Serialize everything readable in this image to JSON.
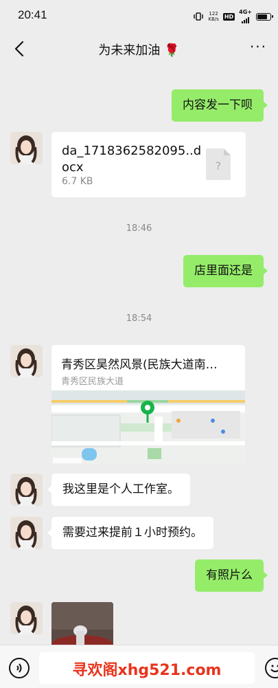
{
  "status": {
    "time": "20:41",
    "speed_value": "122",
    "speed_unit": "KB/s",
    "hd": "HD",
    "network": "4G+",
    "battery_level": 0.85
  },
  "header": {
    "title": "为未来加油 🌹"
  },
  "messages": {
    "m1": "内容发一下呗",
    "file": {
      "name": "da_1718362582095..docx",
      "size": "6.7 KB"
    },
    "time1": "18:46",
    "m2": "店里面还是",
    "time2": "18:54",
    "location": {
      "title": "青秀区昊然风景(民族大道南…",
      "subtitle": "青秀区民族大道"
    },
    "m3": "我这里是个人工作室。",
    "m4": "需要过来提前１小时预约。",
    "m5": "有照片么"
  },
  "watermark": "寻欢阁xhg521.com",
  "colors": {
    "self_bubble": "#95ec69",
    "other_bubble": "#ffffff",
    "background": "#ededed",
    "watermark": "#e8341c"
  }
}
